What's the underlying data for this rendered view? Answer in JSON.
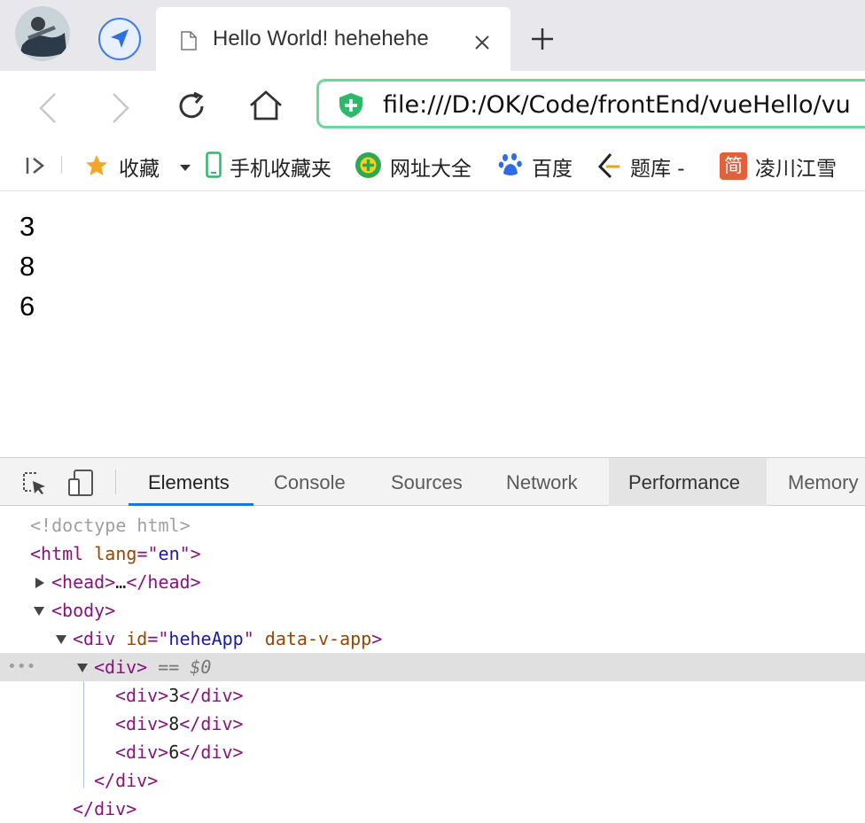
{
  "browser": {
    "tab_title": "Hello World! hehehehe",
    "url": "file:///D:/OK/Code/frontEnd/vueHello/vu"
  },
  "bookmarks": [
    {
      "label": "收藏",
      "icon": "star-icon"
    },
    {
      "label": "手机收藏夹",
      "icon": "phone-icon"
    },
    {
      "label": "网址大全",
      "icon": "plus-circle-icon"
    },
    {
      "label": "百度",
      "icon": "paw-icon"
    },
    {
      "label": "题库 -",
      "icon": "tiku-icon"
    },
    {
      "label": "凌川江雪",
      "icon": "jian-icon"
    }
  ],
  "bookmark_icon_text": "简",
  "page": {
    "lines": [
      "3",
      "8",
      "6"
    ]
  },
  "devtools": {
    "tabs": [
      "Elements",
      "Console",
      "Sources",
      "Network",
      "Performance",
      "Memory"
    ],
    "active_tab": "Elements",
    "dom": {
      "doctype": "<!doctype html>",
      "html_open": "<html lang=\"en\">",
      "head": "<head>…</head>",
      "body_open": "<body>",
      "app_div_open": "<div id=\"heheApp\" data-v-app>",
      "selected_div": "<div>",
      "selected_marker": "== $0",
      "child_divs": [
        "3",
        "8",
        "6"
      ],
      "close_div": "</div>",
      "partial_close": "</div>"
    },
    "ellipsis": "…"
  },
  "colors": {
    "accent": "#1a73e8",
    "url_border": "#6ed89a",
    "tag": "#881280",
    "attr": "#994500",
    "value": "#1a1aa6"
  }
}
